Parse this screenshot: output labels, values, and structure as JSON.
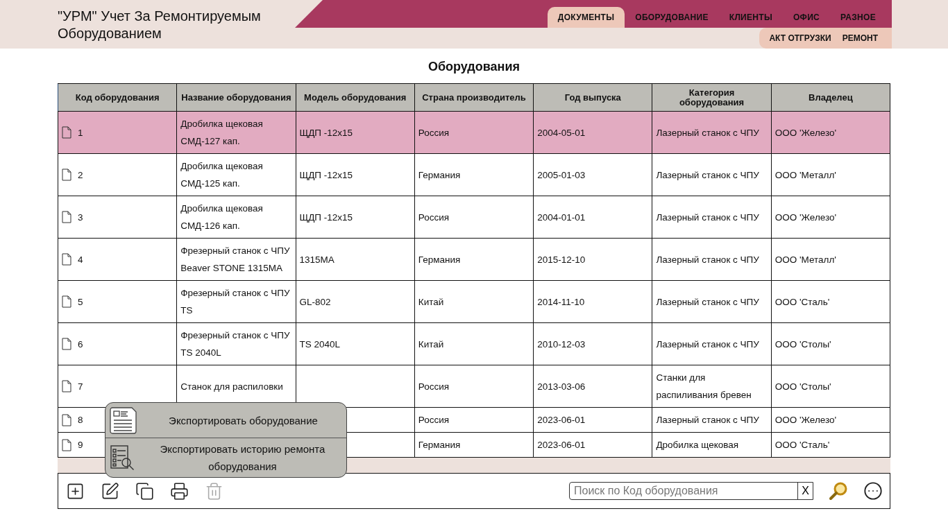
{
  "app_title": "\"УРМ\" Учет За Ремонтируемым Оборудованием",
  "main_tabs": [
    {
      "label": "ДОКУМЕНТЫ",
      "selected": true
    },
    {
      "label": "ОБОРУДОВАНИЕ",
      "selected": false
    },
    {
      "label": "КЛИЕНТЫ",
      "selected": false
    },
    {
      "label": "ОФИС",
      "selected": false
    },
    {
      "label": "РАЗНОЕ",
      "selected": false
    }
  ],
  "sub_tabs": [
    {
      "label": "АКТ ОТГРУЗКИ"
    },
    {
      "label": "РЕМОНТ"
    }
  ],
  "page_title": "Оборудования",
  "table": {
    "columns": [
      "Код оборудования",
      "Название оборудования",
      "Модель оборудования",
      "Страна производитель",
      "Год выпуска",
      "Категория оборудования",
      "Владелец"
    ],
    "rows": [
      {
        "selected": true,
        "cells": [
          "1",
          "Дробилка щековая СМД-127 кап.",
          "ЩДП -12х15",
          "Россия",
          "2004-05-01",
          "Лазерный станок с ЧПУ",
          "ООО 'Железо'"
        ]
      },
      {
        "selected": false,
        "cells": [
          "2",
          "Дробилка щековая СМД-125 кап.",
          "ЩДП -12х15",
          "Германия",
          "2005-01-03",
          "Лазерный станок с ЧПУ",
          "ООО 'Металл'"
        ]
      },
      {
        "selected": false,
        "cells": [
          "3",
          "Дробилка щековая СМД-126 кап.",
          "ЩДП -12х15",
          "Россия",
          "2004-01-01",
          "Лазерный станок с ЧПУ",
          "ООО 'Железо'"
        ]
      },
      {
        "selected": false,
        "cells": [
          "4",
          "Фрезерный станок с ЧПУ Beaver STONE 1315MA",
          "1315MA",
          "Германия",
          "2015-12-10",
          "Лазерный станок с ЧПУ",
          "ООО 'Металл'"
        ]
      },
      {
        "selected": false,
        "cells": [
          "5",
          "Фрезерный станок с ЧПУ TS",
          "GL-802",
          "Китай",
          "2014-11-10",
          "Лазерный станок с ЧПУ",
          "ООО 'Сталь'"
        ]
      },
      {
        "selected": false,
        "cells": [
          "6",
          "Фрезерный станок с ЧПУ TS 2040L",
          "TS 2040L",
          "Китай",
          "2010-12-03",
          "Лазерный станок с ЧПУ",
          "ООО 'Столы'"
        ]
      },
      {
        "selected": false,
        "cells": [
          "7",
          "Станок для распиловки",
          null,
          "Россия",
          "2013-03-06",
          "Станки для распиливания бревен",
          "ООО 'Столы'"
        ]
      },
      {
        "selected": false,
        "cells": [
          "8",
          null,
          null,
          "Россия",
          "2023-06-01",
          "Лазерный станок с ЧПУ",
          "ООО 'Железо'"
        ]
      },
      {
        "selected": false,
        "cells": [
          "9",
          null,
          null,
          "Германия",
          "2023-06-01",
          "Дробилка щековая",
          "ООО 'Сталь'"
        ]
      }
    ]
  },
  "export_menu": [
    {
      "kind": "card",
      "label": "Экспортировать оборудование"
    },
    {
      "kind": "list",
      "label": "Экспортировать историю ремонта оборудования"
    }
  ],
  "toolbar": [
    {
      "kind": "add",
      "disabled": false
    },
    {
      "kind": "edit",
      "disabled": false
    },
    {
      "kind": "copy",
      "disabled": false
    },
    {
      "kind": "print",
      "disabled": false
    },
    {
      "kind": "delete",
      "disabled": true
    }
  ],
  "search": {
    "placeholder": "Поиск по Код оборудования",
    "clear": "X"
  }
}
